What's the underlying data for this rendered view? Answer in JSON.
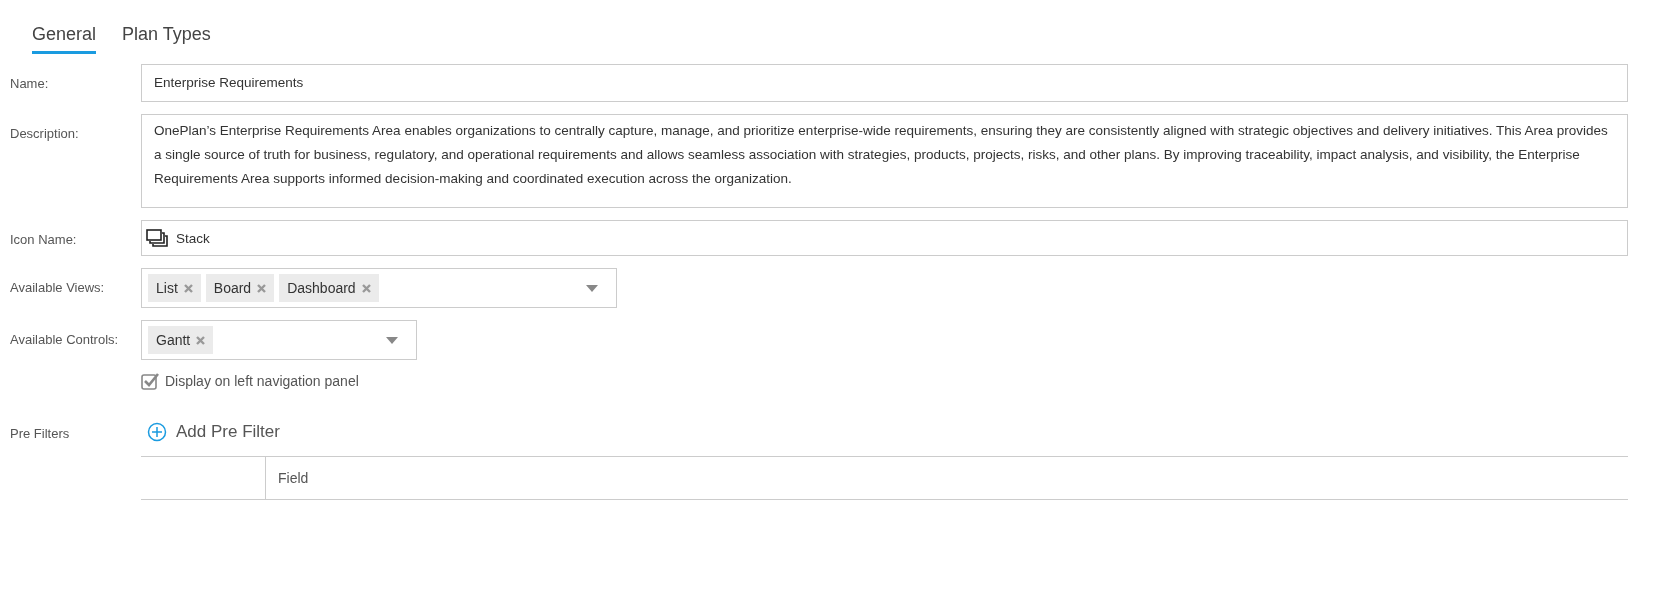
{
  "tabs": [
    {
      "label": "General",
      "selected": true
    },
    {
      "label": "Plan Types",
      "selected": false
    }
  ],
  "form": {
    "name": {
      "label": "Name:",
      "value": "Enterprise Requirements"
    },
    "description": {
      "label": "Description:",
      "value": "OnePlan’s Enterprise Requirements Area enables organizations to centrally capture, manage, and prioritize enterprise-wide requirements, ensuring they are consistently aligned with strategic objectives and delivery initiatives. This Area provides a single source of truth for business, regulatory, and operational requirements and allows seamless association with strategies, products, projects, risks, and other plans. By improving traceability, impact analysis, and visibility, the Enterprise Requirements Area supports informed decision-making and coordinated execution across the organization."
    },
    "icon_name": {
      "label": "Icon Name:",
      "value": "Stack"
    },
    "available_views": {
      "label": "Available Views:",
      "tags": [
        "List",
        "Board",
        "Dashboard"
      ]
    },
    "available_controls": {
      "label": "Available Controls:",
      "tags": [
        "Gantt"
      ]
    },
    "display_on_left_nav": {
      "label": "Display on left navigation panel",
      "checked": true
    }
  },
  "pre_filters": {
    "label": "Pre Filters",
    "add_button": "Add Pre Filter",
    "columns": [
      "Field"
    ]
  }
}
